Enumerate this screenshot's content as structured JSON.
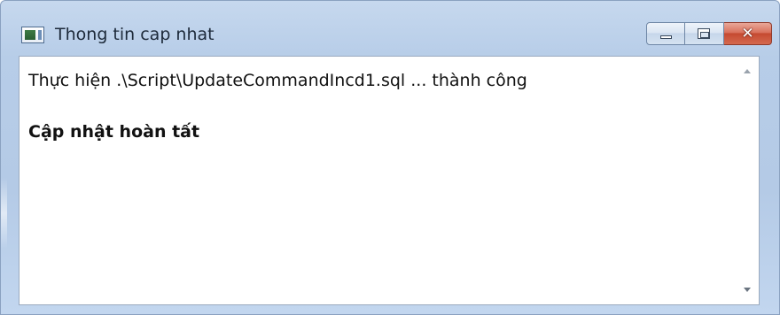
{
  "window": {
    "title": "Thong tin cap nhat",
    "icon": "app-window-icon"
  },
  "caption_buttons": {
    "minimize_icon": "minimize-icon",
    "maximize_icon": "maximize-icon",
    "close_label": "✕"
  },
  "content": {
    "lines": [
      "Thực hiện .\\Script\\UpdateCommandIncd1.sql ... thành công",
      "Cập nhật hoàn tất"
    ]
  },
  "scrollbar": {
    "up_icon": "scroll-up-arrow-icon",
    "down_icon": "scroll-down-arrow-icon"
  },
  "colors": {
    "frame": "#b7cde8",
    "close_button": "#c54a31"
  }
}
